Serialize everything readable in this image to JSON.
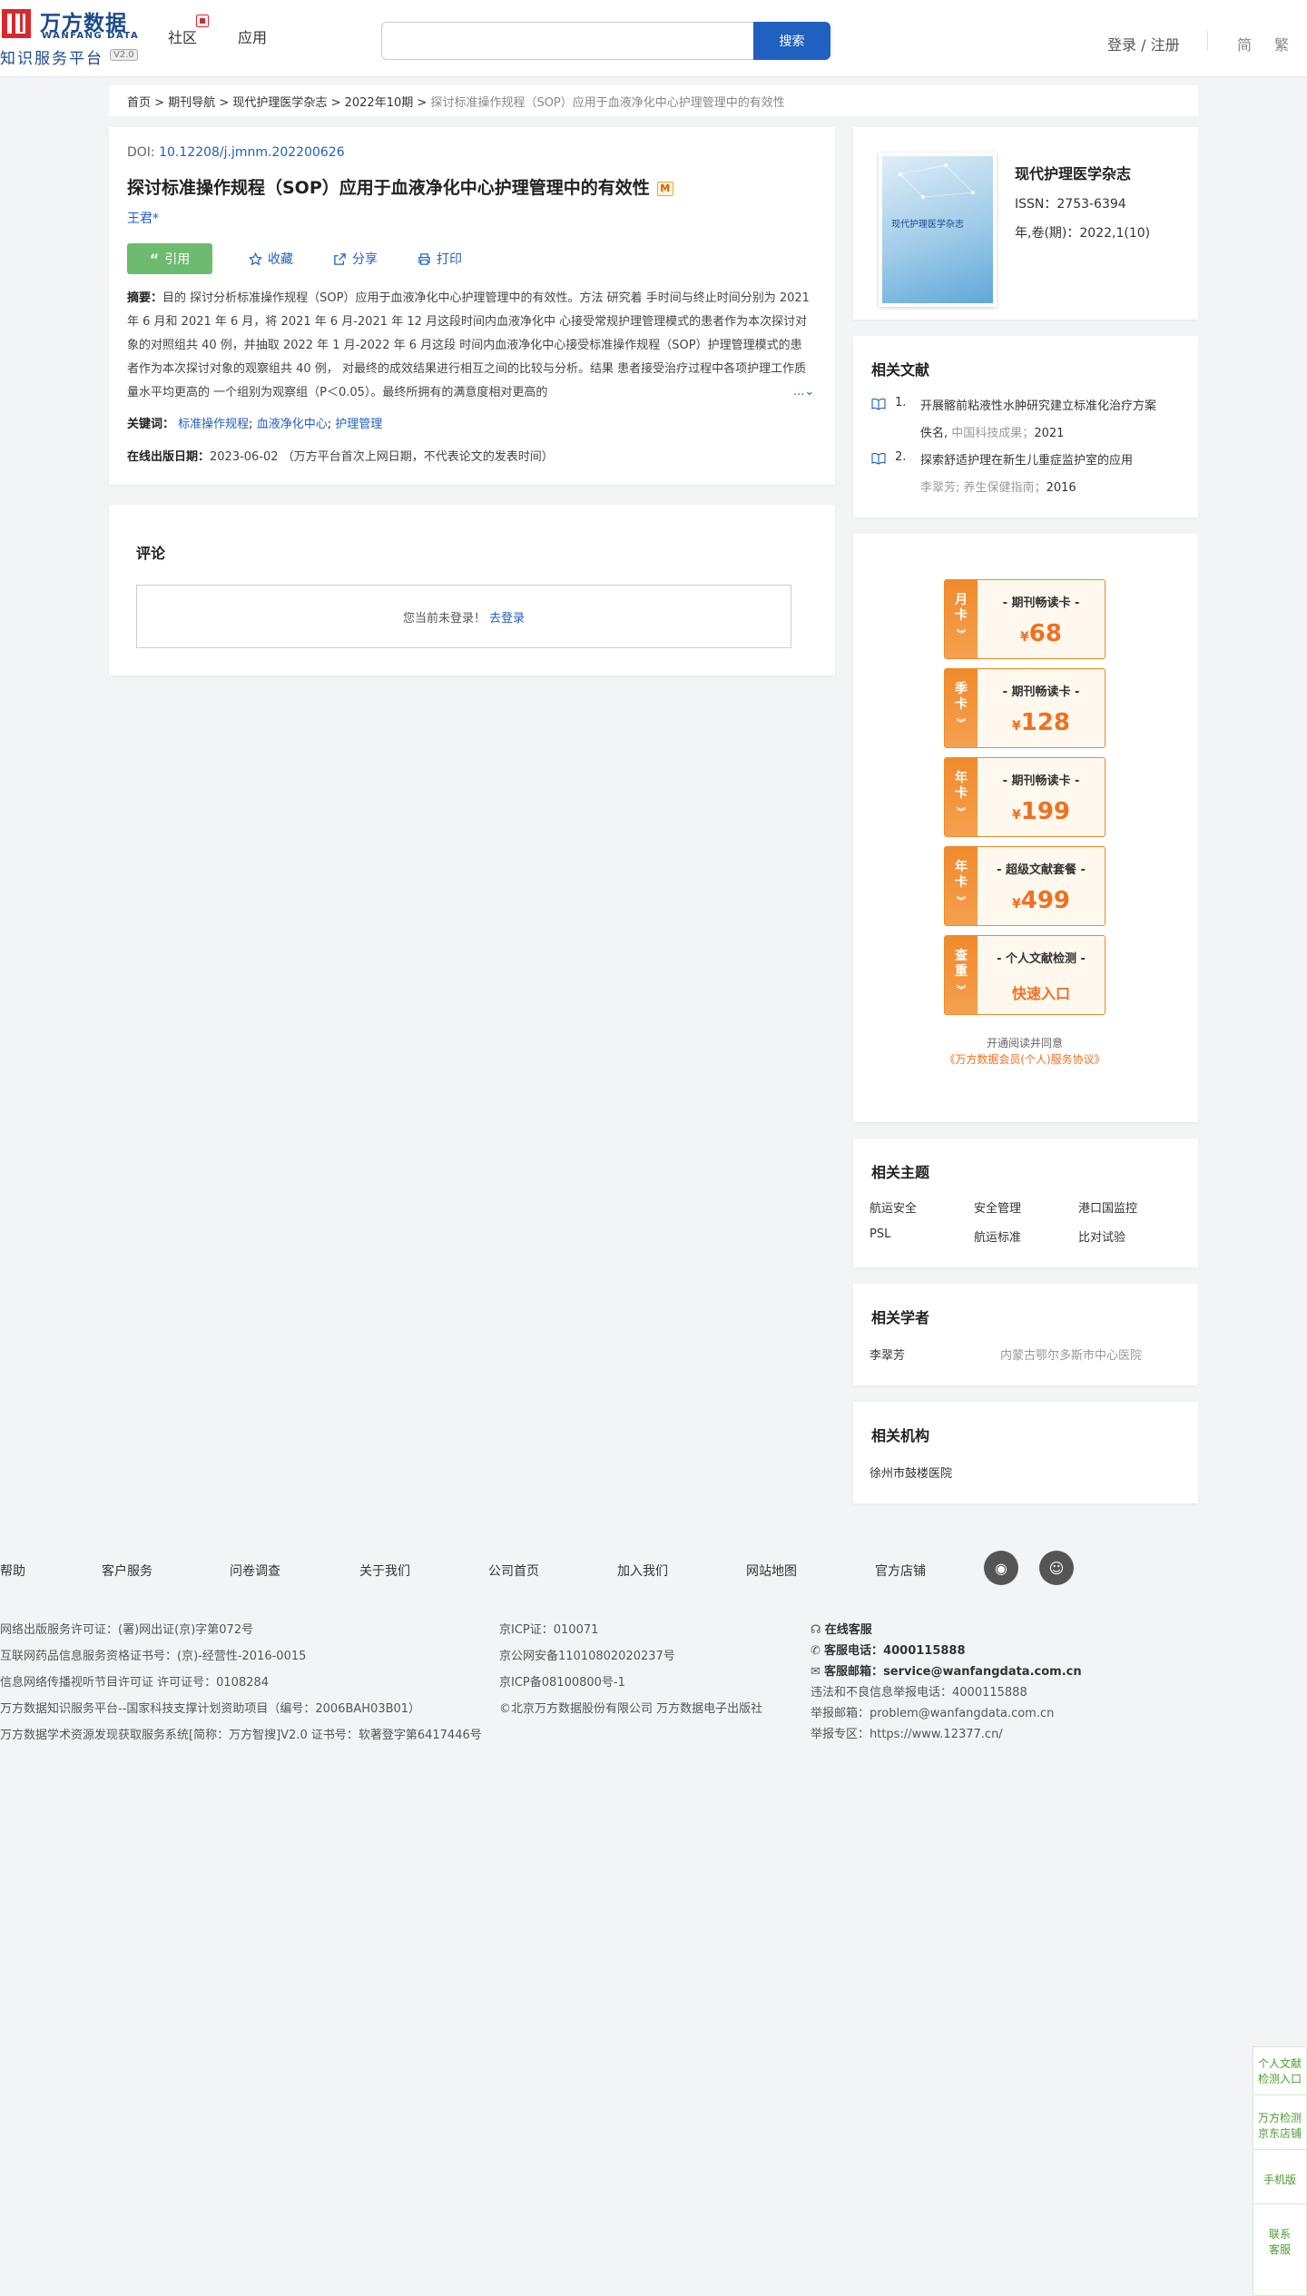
{
  "header": {
    "logo_cn": "万方数据",
    "logo_en": "WANFANG DATA",
    "logo_sub": "知识服务平台",
    "logo_ver": "V2.0",
    "nav": [
      "社区",
      "应用"
    ],
    "search_placeholder": "",
    "search_btn": "搜索",
    "login": "登录 / 注册",
    "lang_simple": "简",
    "lang_trad": "繁"
  },
  "breadcrumb": {
    "items": [
      "首页",
      "期刊导航",
      "现代护理医学杂志",
      "2022年10期"
    ],
    "sep": ">",
    "current": "探讨标准操作规程（SOP）应用于血液净化中心护理管理中的有效性"
  },
  "article": {
    "doi_label": "DOI: ",
    "doi": "10.12208/j.jmnm.202200626",
    "title": "探讨标准操作规程（SOP）应用于血液净化中心护理管理中的有效性",
    "m_badge": "M",
    "author": "王君*",
    "cite": "引用",
    "collect": "收藏",
    "share": "分享",
    "print": "打印",
    "abstract_label": "摘要：",
    "abstract": "目的 探讨分析标准操作规程（SOP）应用于血液净化中心护理管理中的有效性。方法 研究着 手时间与终止时间分别为 2021 年 6 月和 2021 年 6 月，将 2021 年 6 月-2021 年 12 月这段时间内血液净化中 心接受常规护理管理模式的患者作为本次探讨对象的对照组共 40 例，并抽取 2022 年 1 月-2022 年 6 月这段 时间内血液净化中心接受标准操作规程（SOP）护理管理模式的患者作为本次探讨对象的观察组共 40 例， 对最终的成效结果进行相互之间的比较与分析。结果 患者接受治疗过程中各项护理工作质量水平均更高的 一个组别为观察组（P＜0.05）。最终所拥有的满意度相对更高的",
    "abstract_more": "...",
    "keywords_label": "关键词：",
    "keywords": [
      "标准操作规程",
      "血液净化中心",
      "护理管理"
    ],
    "pubdate_label": "在线出版日期：",
    "pubdate": "2023-06-02",
    "pubdate_note": "（万方平台首次上网日期，不代表论文的发表时间）"
  },
  "comment": {
    "title": "评论",
    "not_logged": "您当前未登录！",
    "go_login": "去登录"
  },
  "journal": {
    "cover_text": "现代护理医学杂志",
    "name": "现代护理医学杂志",
    "issn": "ISSN：2753-6394",
    "vol": "年,卷(期)：2022,1(10)"
  },
  "related_docs": {
    "title": "相关文献",
    "items": [
      {
        "num": "1.",
        "title": "开展髂前粘液性水肿研究建立标准化治疗方案",
        "author": "佚名",
        "source": "中国科技成果",
        "year": "2021"
      },
      {
        "num": "2.",
        "title": "探索舒适护理在新生儿重症监护室的应用",
        "author": "李翠芳",
        "source": "养生保健指南",
        "year": "2016"
      }
    ]
  },
  "promo": {
    "cards": [
      {
        "side": [
          "月",
          "卡"
        ],
        "name": "- 期刊畅读卡 -",
        "price": "68"
      },
      {
        "side": [
          "季",
          "卡"
        ],
        "name": "- 期刊畅读卡 -",
        "price": "128"
      },
      {
        "side": [
          "年",
          "卡"
        ],
        "name": "- 期刊畅读卡 -",
        "price": "199"
      },
      {
        "side": [
          "年",
          "卡"
        ],
        "name": "- 超级文献套餐 -",
        "price": "499"
      },
      {
        "side": [
          "查",
          "重"
        ],
        "name": "- 个人文献检测 -",
        "price_text": "快速入口"
      }
    ],
    "currency": "¥",
    "note1": "开通阅读并同意",
    "note2": "《万方数据会员(个人)服务协议》"
  },
  "topics": {
    "title": "相关主题",
    "items": [
      "航运安全",
      "安全管理",
      "港口国监控",
      "PSL",
      "航运标准",
      "比对试验"
    ]
  },
  "scholars": {
    "title": "相关学者",
    "name": "李翠芳",
    "org": "内蒙古鄂尔多斯市中心医院"
  },
  "orgs": {
    "title": "相关机构",
    "name": "徐州市鼓楼医院"
  },
  "footer": {
    "nav": [
      "帮助",
      "客户服务",
      "问卷调查",
      "关于我们",
      "公司首页",
      "加入我们",
      "网站地图",
      "官方店铺"
    ],
    "col1": [
      "网络出版服务许可证：(署)网出证(京)字第072号",
      "互联网药品信息服务资格证书号：(京)-经营性-2016-0015",
      "信息网络传播视听节目许可证 许可证号：0108284",
      "万方数据知识服务平台--国家科技支撑计划资助项目（编号：2006BAH03B01）",
      "万方数据学术资源发现获取服务系统[简称：万方智搜]V2.0 证书号：软著登字第6417446号"
    ],
    "col2": [
      "京ICP证：010071",
      "京公网安备11010802020237号",
      "京ICP备08100800号-1",
      "©北京万方数据股份有限公司 万方数据电子出版社"
    ],
    "online_service": "在线客服",
    "phone_label": "客服电话：",
    "phone": "4000115888",
    "email_label": "客服邮箱：",
    "email": "service@wanfangdata.com.cn",
    "report_line": "违法和不良信息举报电话：4000115888",
    "report_email": "举报邮箱：problem@wanfangdata.com.cn",
    "report_site": "举报专区：https://www.12377.cn/"
  },
  "float_side": {
    "items": [
      "个人文献检测入口",
      "万方检测京东店铺",
      "手机版",
      "联系客服"
    ]
  }
}
